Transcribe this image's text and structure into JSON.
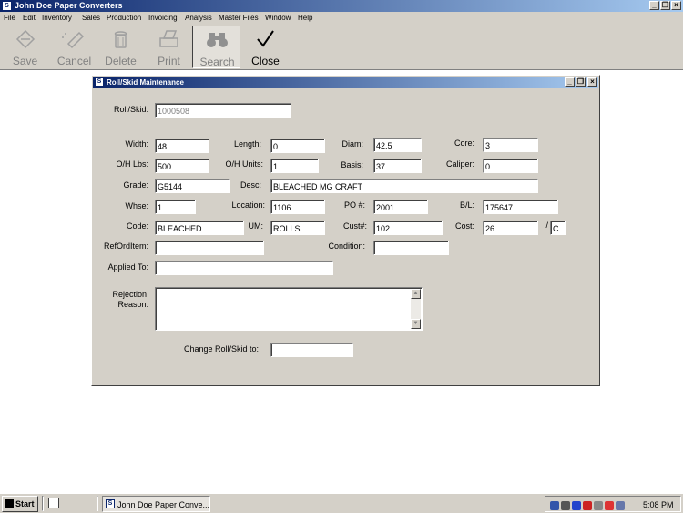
{
  "app": {
    "title": "John Doe Paper Converters",
    "icon_letter": "S",
    "controls": {
      "minimize": "_",
      "restore": "❐",
      "close": "×"
    }
  },
  "menu": [
    "File",
    "Edit",
    "Inventory",
    "Sales",
    "Production",
    "Invoicing",
    "Analysis",
    "Master Files",
    "Window",
    "Help"
  ],
  "toolbar": {
    "save": "Save",
    "cancel": "Cancel",
    "delete": "Delete",
    "print": "Print",
    "search": "Search",
    "close": "Close"
  },
  "child": {
    "title": "Roll/Skid Maintenance",
    "controls": {
      "minimize": "_",
      "restore": "❐",
      "close": "×"
    }
  },
  "form": {
    "roll_skid": {
      "label": "Roll/Skid:",
      "value": "1000508"
    },
    "width": {
      "label": "Width:",
      "value": "48"
    },
    "length": {
      "label": "Length:",
      "value": "0"
    },
    "diam": {
      "label": "Diam:",
      "value": "42.5"
    },
    "core": {
      "label": "Core:",
      "value": "3"
    },
    "oh_lbs": {
      "label": "O/H Lbs:",
      "value": "500"
    },
    "oh_units": {
      "label": "O/H Units:",
      "value": "1"
    },
    "basis": {
      "label": "Basis:",
      "value": "37"
    },
    "caliper": {
      "label": "Caliper:",
      "value": "0"
    },
    "grade": {
      "label": "Grade:",
      "value": "G5144"
    },
    "desc": {
      "label": "Desc:",
      "value": "BLEACHED MG CRAFT"
    },
    "whse": {
      "label": "Whse:",
      "value": "1"
    },
    "location": {
      "label": "Location:",
      "value": "1106"
    },
    "po": {
      "label": "PO #:",
      "value": "2001"
    },
    "bl": {
      "label": "B/L:",
      "value": "175647"
    },
    "code": {
      "label": "Code:",
      "value": "BLEACHED"
    },
    "um": {
      "label": "UM:",
      "value": "ROLLS"
    },
    "cust": {
      "label": "Cust#:",
      "value": "102"
    },
    "cost": {
      "label": "Cost:",
      "value": "26",
      "separator": "/",
      "unit": "C"
    },
    "ref_ord_item": {
      "label": "RefOrdItem:",
      "value": ""
    },
    "condition": {
      "label": "Condition:",
      "value": ""
    },
    "applied_to": {
      "label": "Applied To:",
      "value": ""
    },
    "rejection_reason": {
      "label_line1": "Rejection",
      "label_line2": "Reason:",
      "value": ""
    },
    "change_roll_skid": {
      "label": "Change Roll/Skid  to:",
      "value": ""
    }
  },
  "taskbar": {
    "start": "Start",
    "task": "John Doe Paper Conve...",
    "time": "5:08 PM"
  }
}
